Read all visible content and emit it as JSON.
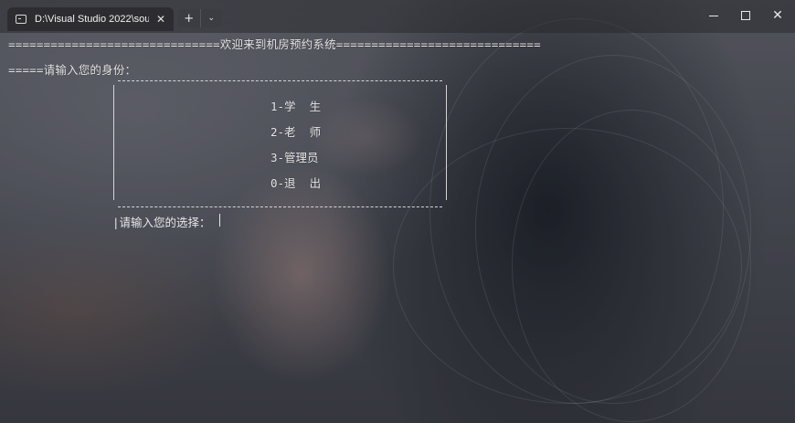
{
  "window": {
    "tab_title": "D:\\Visual Studio 2022\\source\\",
    "new_tab_label": "+",
    "dropdown_label": "⌄",
    "close_tab": "✕",
    "close_window": "✕"
  },
  "console": {
    "banner": "==============================欢迎来到机房预约系统=============================",
    "identity_prompt": "=====请输入您的身份：",
    "menu": [
      {
        "label": "1-学  生"
      },
      {
        "label": "2-老  师"
      },
      {
        "label": "3-管理员"
      },
      {
        "label": "0-退  出"
      }
    ],
    "choice_prompt": "请输入您的选择："
  },
  "colors": {
    "text": "#e6e6e6",
    "titlebar": "#202024",
    "tab": "#2c2c30"
  }
}
